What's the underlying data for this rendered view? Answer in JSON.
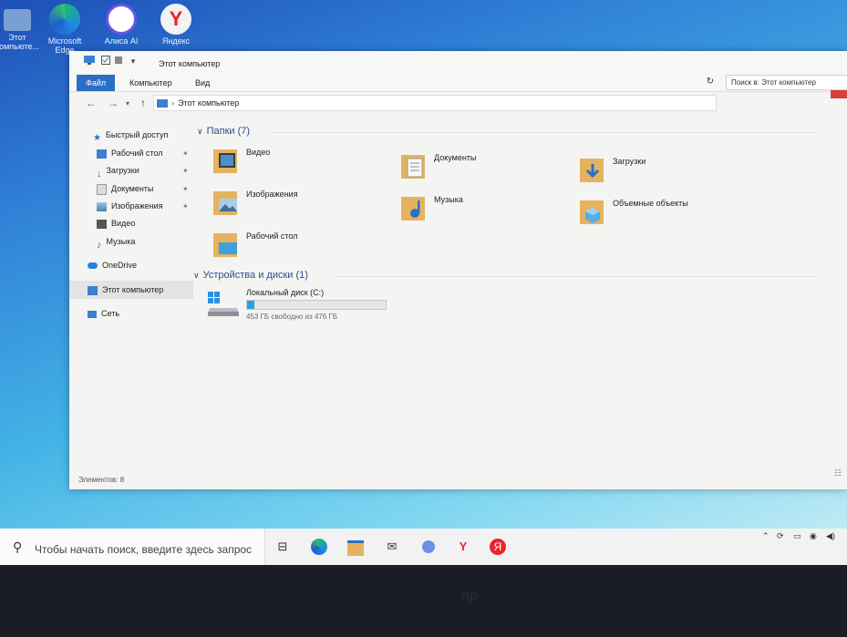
{
  "desktop": {
    "icons": [
      {
        "label": "Этот компьюте...",
        "icon": "pc-icon"
      },
      {
        "label": "Microsoft Edge",
        "icon": "edge-icon"
      },
      {
        "label": "Алиса AI",
        "icon": "alice-icon"
      },
      {
        "label": "Яндекс",
        "icon": "yandex-icon"
      }
    ]
  },
  "window": {
    "title": "Этот компьютер",
    "tabs": [
      {
        "label": "Файл"
      },
      {
        "label": "Компьютер"
      },
      {
        "label": "Вид"
      }
    ],
    "address": {
      "path": "Этот компьютер"
    },
    "search": {
      "placeholder": "Поиск в: Этот компьютер"
    },
    "sidebar": {
      "quick_access": "Быстрый доступ",
      "items": [
        {
          "label": "Рабочий стол"
        },
        {
          "label": "Загрузки"
        },
        {
          "label": "Документы"
        },
        {
          "label": "Изображения"
        },
        {
          "label": "Видео"
        },
        {
          "label": "Музыка"
        }
      ],
      "onedrive": "OneDrive",
      "this_pc": "Этот компьютер",
      "network": "Сеть"
    },
    "folders_group": "Папки (7)",
    "folders": [
      {
        "label": "Видео"
      },
      {
        "label": "Документы"
      },
      {
        "label": "Загрузки"
      },
      {
        "label": "Изображения"
      },
      {
        "label": "Музыка"
      },
      {
        "label": "Объемные объекты"
      },
      {
        "label": "Рабочий стол"
      }
    ],
    "devices_group": "Устройства и диски (1)",
    "drive": {
      "name": "Локальный диск (C:)",
      "free": "453 ГБ свободно из 476 ГБ",
      "used_fraction": 0.05
    },
    "status": "Элементов: 8"
  },
  "taskbar": {
    "search_placeholder": "Чтобы начать поиск, введите здесь запрос"
  },
  "colors": {
    "accent": "#2b6fc4",
    "close": "#d8413a",
    "drive_bar": "#27a0e6",
    "folder": "#e5b35f"
  }
}
